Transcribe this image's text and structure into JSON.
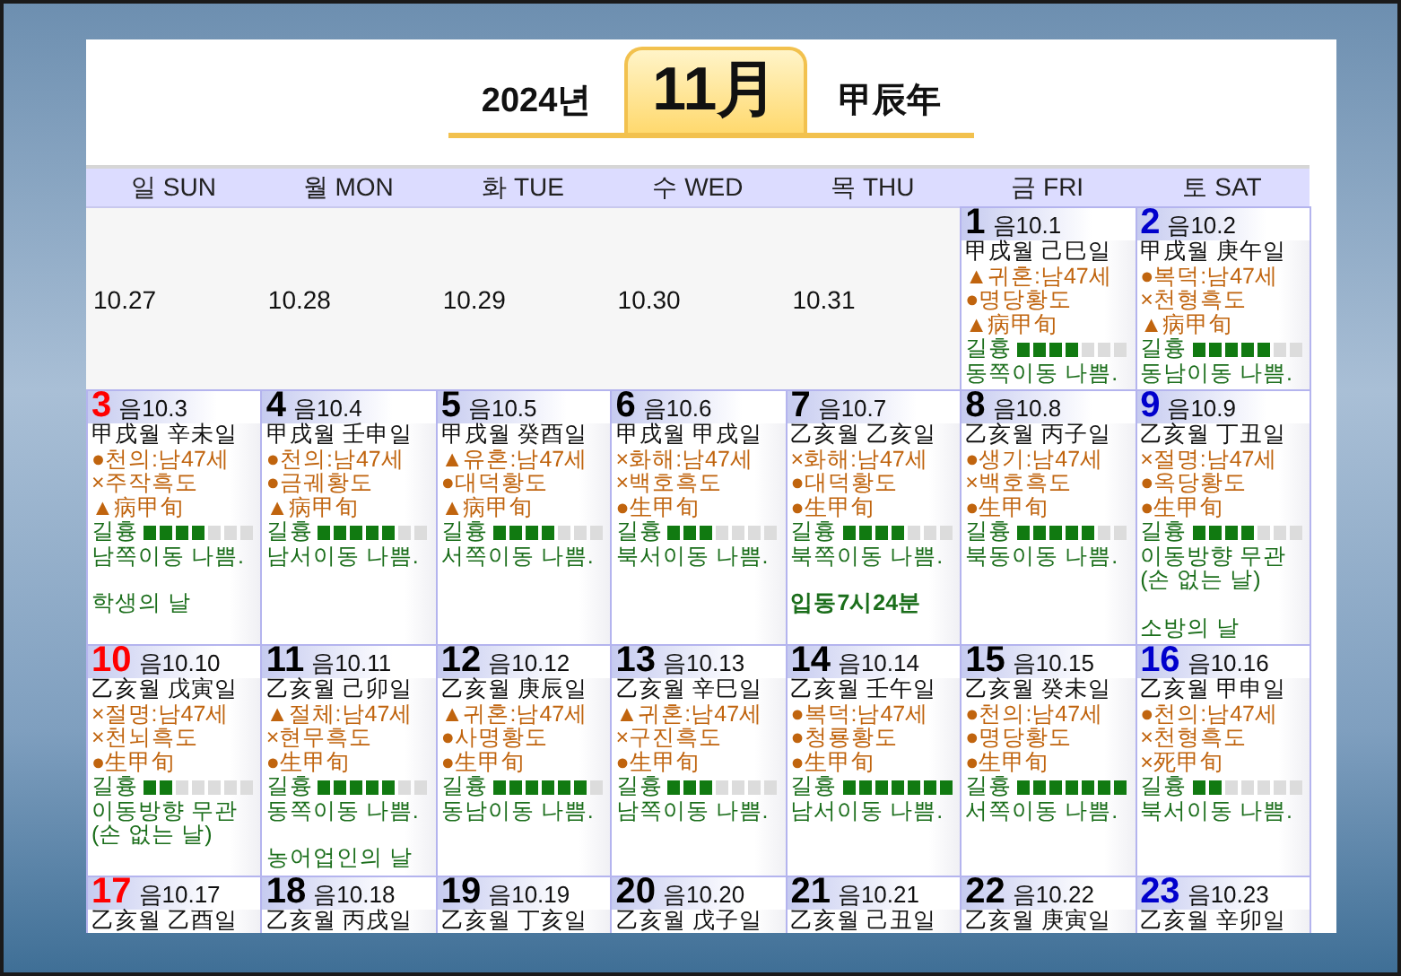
{
  "header": {
    "year": "2024년",
    "month": "11月",
    "year_ganji": "甲辰年"
  },
  "weekdays": [
    "일 SUN",
    "월 MON",
    "화 TUE",
    "수 WED",
    "목 THU",
    "금 FRI",
    "토 SAT"
  ],
  "weeks": [
    [
      {
        "kind": "other",
        "date": "10.27"
      },
      {
        "kind": "other",
        "date": "10.28"
      },
      {
        "kind": "other",
        "date": "10.29"
      },
      {
        "kind": "other",
        "date": "10.30"
      },
      {
        "kind": "other",
        "date": "10.31"
      },
      {
        "kind": "day",
        "day": "1",
        "color": "#000000",
        "lunar": "음10.1",
        "ganji": "甲戌월 己巳일",
        "omens": [
          "▲귀혼:남47세",
          "●명당황도",
          "▲病甲旬"
        ],
        "fortune_label": "길흉",
        "level": 0.5714,
        "direction": "동쪽이동 나쁨."
      },
      {
        "kind": "day",
        "day": "2",
        "color": "#0000cc",
        "lunar": "음10.2",
        "ganji": "甲戌월 庚午일",
        "omens": [
          "●복덕:남47세",
          "×천형흑도",
          "▲病甲旬"
        ],
        "fortune_label": "길흉",
        "level": 0.7143,
        "direction": "동남이동 나쁨."
      }
    ],
    [
      {
        "kind": "day",
        "day": "3",
        "color": "#ff0000",
        "lunar": "음10.3",
        "ganji": "甲戌월 辛未일",
        "omens": [
          "●천의:남47세",
          "×주작흑도",
          "▲病甲旬"
        ],
        "fortune_label": "길흉",
        "level": 0.5714,
        "direction": "남쪽이동 나쁨.",
        "notes": [
          {
            "kind": "holiday",
            "text": "학생의 날"
          }
        ]
      },
      {
        "kind": "day",
        "day": "4",
        "color": "#000000",
        "lunar": "음10.4",
        "ganji": "甲戌월 壬申일",
        "omens": [
          "●천의:남47세",
          "●금궤황도",
          "▲病甲旬"
        ],
        "fortune_label": "길흉",
        "level": 0.7143,
        "direction": "남서이동 나쁨."
      },
      {
        "kind": "day",
        "day": "5",
        "color": "#000000",
        "lunar": "음10.5",
        "ganji": "甲戌월 癸酉일",
        "omens": [
          "▲유혼:남47세",
          "●대덕황도",
          "▲病甲旬"
        ],
        "fortune_label": "길흉",
        "level": 0.5714,
        "direction": "서쪽이동 나쁨."
      },
      {
        "kind": "day",
        "day": "6",
        "color": "#000000",
        "lunar": "음10.6",
        "ganji": "甲戌월 甲戌일",
        "omens": [
          "×화해:남47세",
          "×백호흑도",
          "●生甲旬"
        ],
        "fortune_label": "길흉",
        "level": 0.4286,
        "direction": "북서이동 나쁨."
      },
      {
        "kind": "day",
        "day": "7",
        "color": "#000000",
        "lunar": "음10.7",
        "ganji": "乙亥월 乙亥일",
        "omens": [
          "×화해:남47세",
          "●대덕황도",
          "●生甲旬"
        ],
        "fortune_label": "길흉",
        "level": 0.5714,
        "direction": "북쪽이동 나쁨.",
        "notes": [
          {
            "kind": "solar_term",
            "text": "입동7시24분"
          }
        ]
      },
      {
        "kind": "day",
        "day": "8",
        "color": "#000000",
        "lunar": "음10.8",
        "ganji": "乙亥월 丙子일",
        "omens": [
          "●생기:남47세",
          "×백호흑도",
          "●生甲旬"
        ],
        "fortune_label": "길흉",
        "level": 0.7143,
        "direction": "북동이동 나쁨."
      },
      {
        "kind": "day",
        "day": "9",
        "color": "#0000cc",
        "lunar": "음10.9",
        "ganji": "乙亥월 丁丑일",
        "omens": [
          "×절명:남47세",
          "●옥당황도",
          "●生甲旬"
        ],
        "fortune_label": "길흉",
        "level": 0.5714,
        "direction": "이동방향 무관 (손 없는 날)",
        "notes": [
          {
            "kind": "holiday",
            "text": "소방의 날"
          }
        ]
      }
    ],
    [
      {
        "kind": "day",
        "day": "10",
        "color": "#ff0000",
        "lunar": "음10.10",
        "ganji": "乙亥월 戊寅일",
        "omens": [
          "×절명:남47세",
          "×천뇌흑도",
          "●生甲旬"
        ],
        "fortune_label": "길흉",
        "level": 0.2857,
        "direction": "이동방향 무관 (손 없는 날)"
      },
      {
        "kind": "day",
        "day": "11",
        "color": "#000000",
        "lunar": "음10.11",
        "ganji": "乙亥월 己卯일",
        "omens": [
          "▲절체:남47세",
          "×현무흑도",
          "●生甲旬"
        ],
        "fortune_label": "길흉",
        "level": 0.7143,
        "direction": "동쪽이동 나쁨.",
        "notes": [
          {
            "kind": "holiday",
            "text": "농어업인의 날"
          }
        ]
      },
      {
        "kind": "day",
        "day": "12",
        "color": "#000000",
        "lunar": "음10.12",
        "ganji": "乙亥월 庚辰일",
        "omens": [
          "▲귀혼:남47세",
          "●사명황도",
          "●生甲旬"
        ],
        "fortune_label": "길흉",
        "level": 0.8571,
        "direction": "동남이동 나쁨."
      },
      {
        "kind": "day",
        "day": "13",
        "color": "#000000",
        "lunar": "음10.13",
        "ganji": "乙亥월 辛巳일",
        "omens": [
          "▲귀혼:남47세",
          "×구진흑도",
          "●生甲旬"
        ],
        "fortune_label": "길흉",
        "level": 0.4286,
        "direction": "남쪽이동 나쁨."
      },
      {
        "kind": "day",
        "day": "14",
        "color": "#000000",
        "lunar": "음10.14",
        "ganji": "乙亥월 壬午일",
        "omens": [
          "●복덕:남47세",
          "●청룡황도",
          "●生甲旬"
        ],
        "fortune_label": "길흉",
        "level": 1,
        "direction": "남서이동 나쁨."
      },
      {
        "kind": "day",
        "day": "15",
        "color": "#000000",
        "lunar": "음10.15",
        "ganji": "乙亥월 癸未일",
        "omens": [
          "●천의:남47세",
          "●명당황도",
          "●生甲旬"
        ],
        "fortune_label": "길흉",
        "level": 1,
        "direction": "서쪽이동 나쁨."
      },
      {
        "kind": "day",
        "day": "16",
        "color": "#0000cc",
        "lunar": "음10.16",
        "ganji": "乙亥월 甲申일",
        "omens": [
          "●천의:남47세",
          "×천형흑도",
          "×死甲旬"
        ],
        "fortune_label": "길흉",
        "level": 0.2857,
        "direction": "북서이동 나쁨."
      }
    ],
    [
      {
        "kind": "day",
        "day": "17",
        "color": "#ff0000",
        "lunar": "음10.17",
        "ganji": "乙亥월 乙酉일"
      },
      {
        "kind": "day",
        "day": "18",
        "color": "#000000",
        "lunar": "음10.18",
        "ganji": "乙亥월 丙戌일"
      },
      {
        "kind": "day",
        "day": "19",
        "color": "#000000",
        "lunar": "음10.19",
        "ganji": "乙亥월 丁亥일"
      },
      {
        "kind": "day",
        "day": "20",
        "color": "#000000",
        "lunar": "음10.20",
        "ganji": "乙亥월 戊子일"
      },
      {
        "kind": "day",
        "day": "21",
        "color": "#000000",
        "lunar": "음10.21",
        "ganji": "乙亥월 己丑일"
      },
      {
        "kind": "day",
        "day": "22",
        "color": "#000000",
        "lunar": "음10.22",
        "ganji": "乙亥월 庚寅일"
      },
      {
        "kind": "day",
        "day": "23",
        "color": "#0000cc",
        "lunar": "음10.23",
        "ganji": "乙亥월 辛卯일"
      }
    ]
  ]
}
